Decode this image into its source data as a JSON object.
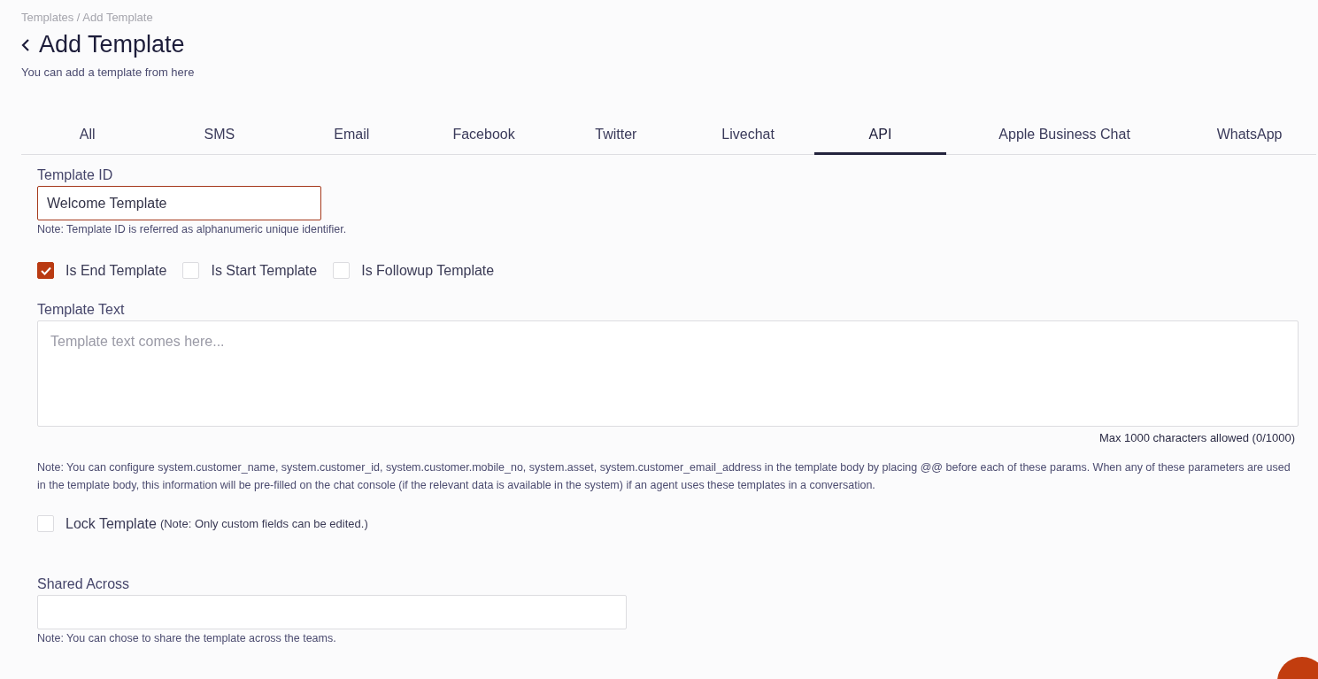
{
  "breadcrumb": "Templates / Add Template",
  "title": "Add Template",
  "subtitle": "You can add a template from here",
  "tabs": [
    {
      "label": "All",
      "selected": false
    },
    {
      "label": "SMS",
      "selected": false
    },
    {
      "label": "Email",
      "selected": false
    },
    {
      "label": "Facebook",
      "selected": false
    },
    {
      "label": "Twitter",
      "selected": false
    },
    {
      "label": "Livechat",
      "selected": false
    },
    {
      "label": "API",
      "selected": true
    },
    {
      "label": "Apple Business Chat",
      "selected": false
    },
    {
      "label": "WhatsApp",
      "selected": false
    }
  ],
  "template_id": {
    "label": "Template ID",
    "value": "Welcome Template",
    "note": "Note: Template ID is referred as alphanumeric unique identifier."
  },
  "options": [
    {
      "label": "Is End Template",
      "checked": true
    },
    {
      "label": "Is Start Template",
      "checked": false
    },
    {
      "label": "Is Followup Template",
      "checked": false
    }
  ],
  "template_text": {
    "label": "Template Text",
    "placeholder": "Template text comes here...",
    "counter": "Max 1000 characters allowed (0/1000)",
    "note": "Note: You can configure system.customer_name, system.customer_id, system.customer.mobile_no, system.asset, system.customer_email_address in the template body by placing @@ before each of these params. When any of these parameters are used in the template body, this information will be pre-filled on the chat console (if the relevant data is available in the system) if an agent uses these templates in a conversation."
  },
  "lock": {
    "label": "Lock Template",
    "hint": "(Note: Only custom fields can be edited.)",
    "checked": false
  },
  "shared_across": {
    "label": "Shared Across",
    "note": "Note: You can chose to share the template across the teams."
  }
}
